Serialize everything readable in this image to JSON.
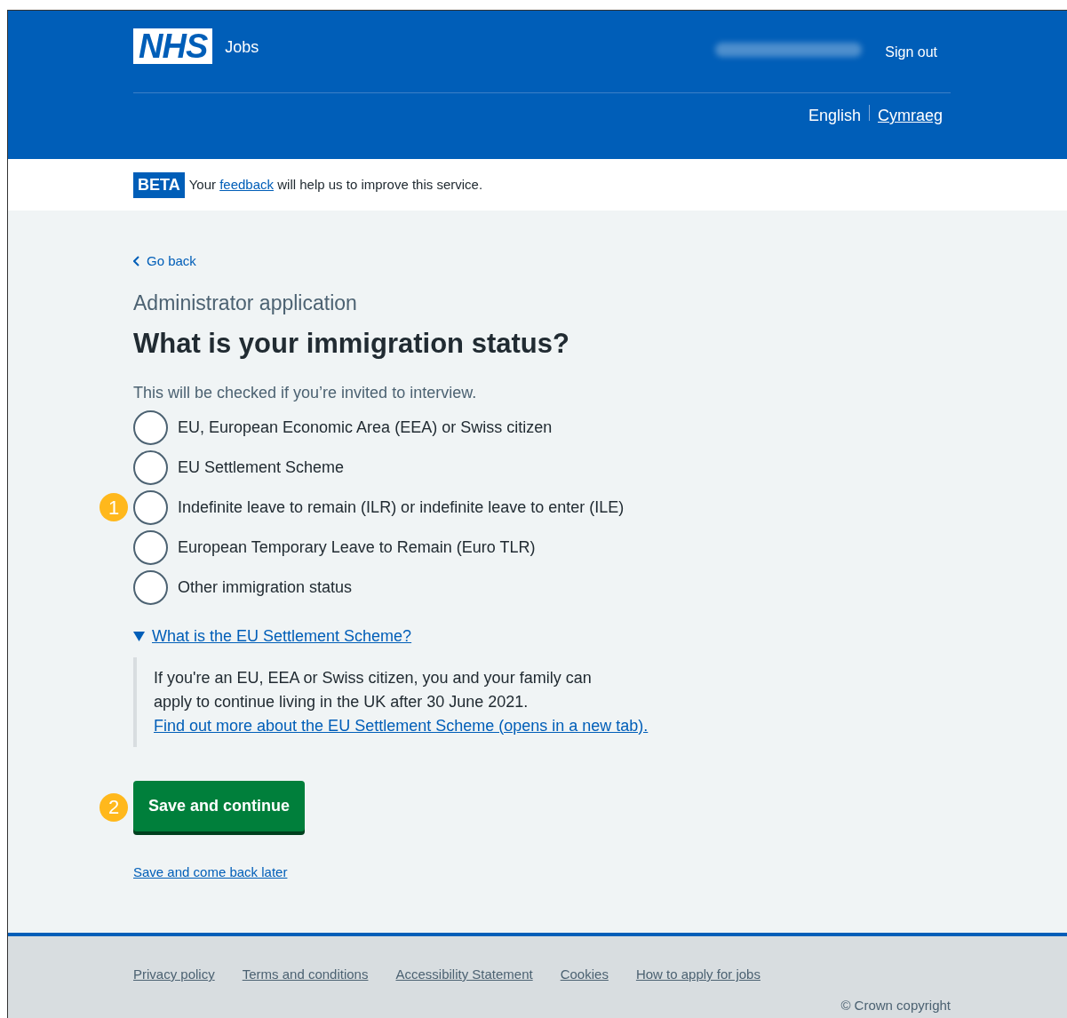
{
  "header": {
    "logo": "NHS",
    "service": "Jobs",
    "sign_out": "Sign out",
    "languages": [
      {
        "label": "English",
        "selected": true
      },
      {
        "label": "Cymraeg",
        "selected": false
      }
    ]
  },
  "beta_banner": {
    "tag": "BETA",
    "link": "feedback",
    "before": "Your ",
    "after": " will help us to improve this service."
  },
  "back_link": "Go back",
  "caption": "Administrator application",
  "heading": "What is your immigration status?",
  "hint": "This will be checked if you’re invited to interview.",
  "options": [
    {
      "label": "EU, European Economic Area (EEA) or Swiss citizen",
      "selected": false
    },
    {
      "label": "EU Settlement Scheme",
      "selected": false
    },
    {
      "label": "Indefinite leave to remain (ILR) or indefinite leave to enter (ILE)",
      "selected": false,
      "annotation": "1"
    },
    {
      "label": "European Temporary Leave to Remain (Euro TLR)",
      "selected": false
    },
    {
      "label": "Other immigration status",
      "selected": false
    }
  ],
  "details": {
    "summary": "What is the EU Settlement Scheme?",
    "expanded": true,
    "text": "If you're an EU, EEA or Swiss citizen, you and your family can apply to continue living in the UK after 30 June 2021. ",
    "link": "Find out more about the EU Settlement Scheme (opens in a new tab)."
  },
  "primary_button": {
    "label": "Save and continue",
    "annotation": "2"
  },
  "secondary_link": "Save and come back later",
  "footer": {
    "links": [
      "Privacy policy",
      "Terms and conditions",
      "Accessibility Statement",
      "Cookies",
      "How to apply for jobs"
    ],
    "copyright": "© Crown copyright"
  }
}
